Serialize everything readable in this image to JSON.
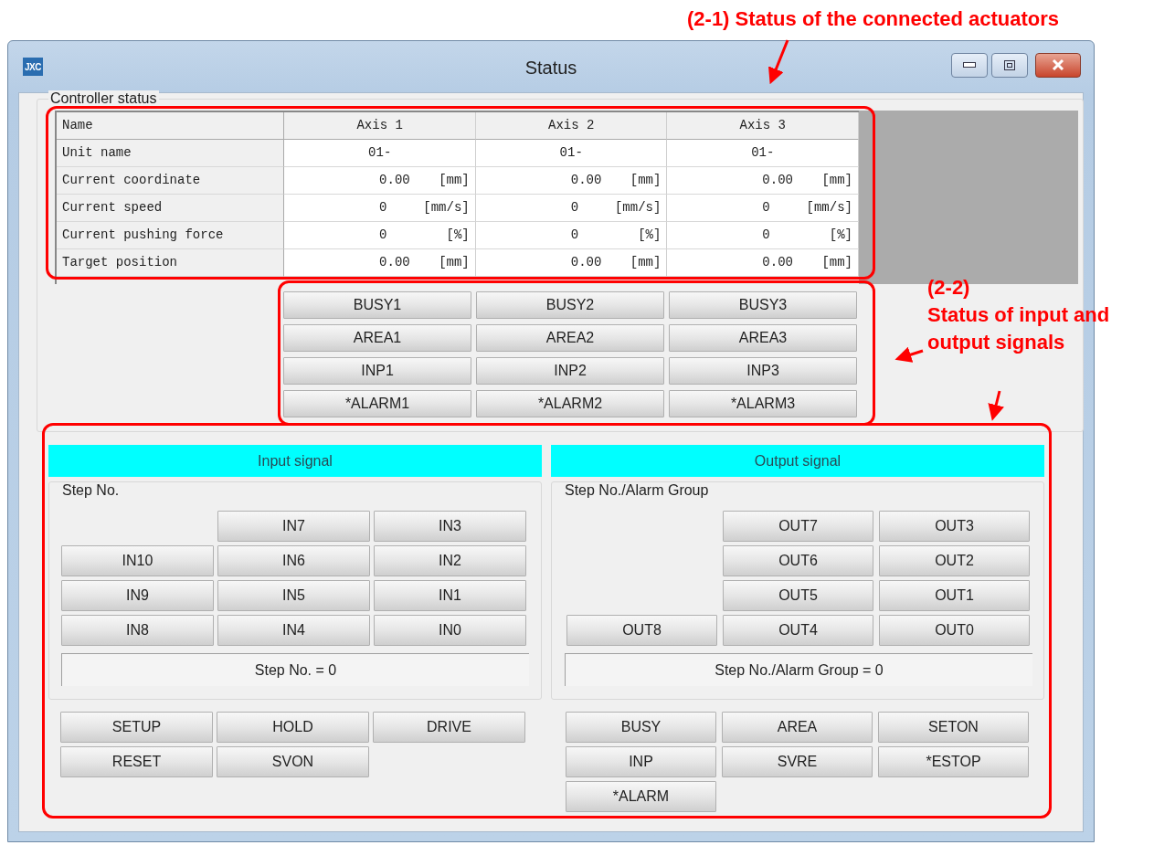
{
  "window": {
    "logo": "JXC",
    "title": "Status"
  },
  "controller_status": {
    "label": "Controller status",
    "table": {
      "columns": [
        "Name",
        "Axis 1",
        "Axis 2",
        "Axis 3"
      ],
      "rows": [
        {
          "name": "Unit name",
          "cells": [
            {
              "value": "01-"
            },
            {
              "value": "01-"
            },
            {
              "value": "01-"
            }
          ]
        },
        {
          "name": "Current coordinate",
          "cells": [
            {
              "value": "0.00",
              "unit": "[mm]"
            },
            {
              "value": "0.00",
              "unit": "[mm]"
            },
            {
              "value": "0.00",
              "unit": "[mm]"
            }
          ]
        },
        {
          "name": "Current speed",
          "cells": [
            {
              "value": "0",
              "unit": "[mm/s]"
            },
            {
              "value": "0",
              "unit": "[mm/s]"
            },
            {
              "value": "0",
              "unit": "[mm/s]"
            }
          ]
        },
        {
          "name": "Current pushing force",
          "cells": [
            {
              "value": "0",
              "unit": "[%]"
            },
            {
              "value": "0",
              "unit": "[%]"
            },
            {
              "value": "0",
              "unit": "[%]"
            }
          ]
        },
        {
          "name": "Target position",
          "cells": [
            {
              "value": "0.00",
              "unit": "[mm]"
            },
            {
              "value": "0.00",
              "unit": "[mm]"
            },
            {
              "value": "0.00",
              "unit": "[mm]"
            }
          ]
        }
      ]
    },
    "axis_signals": [
      [
        "BUSY1",
        "BUSY2",
        "BUSY3"
      ],
      [
        "AREA1",
        "AREA2",
        "AREA3"
      ],
      [
        "INP1",
        "INP2",
        "INP3"
      ],
      [
        "*ALARM1",
        "*ALARM2",
        "*ALARM3"
      ]
    ]
  },
  "input_signal": {
    "title": "Input signal",
    "group_label": "Step No.",
    "grid": [
      [
        "IN7",
        "IN3"
      ],
      [
        "IN10",
        "IN6",
        "IN2"
      ],
      [
        "IN9",
        "IN5",
        "IN1"
      ],
      [
        "IN8",
        "IN4",
        "IN0"
      ]
    ],
    "display": "Step No. = 0",
    "buttons": [
      [
        "SETUP",
        "HOLD",
        "DRIVE"
      ],
      [
        "RESET",
        "SVON"
      ]
    ]
  },
  "output_signal": {
    "title": "Output signal",
    "group_label": "Step No./Alarm Group",
    "grid": [
      [
        "OUT7",
        "OUT3"
      ],
      [
        "OUT6",
        "OUT2"
      ],
      [
        "OUT5",
        "OUT1"
      ],
      [
        "OUT8",
        "OUT4",
        "OUT0"
      ]
    ],
    "display": "Step No./Alarm Group = 0",
    "buttons": [
      [
        "BUSY",
        "AREA",
        "SETON"
      ],
      [
        "INP",
        "SVRE",
        "*ESTOP"
      ],
      [
        "*ALARM"
      ]
    ]
  },
  "annotations": [
    {
      "label": "(2-1) Status of the connected actuators"
    },
    {
      "label": "(2-2)",
      "text": "Status of input and output signals"
    }
  ]
}
